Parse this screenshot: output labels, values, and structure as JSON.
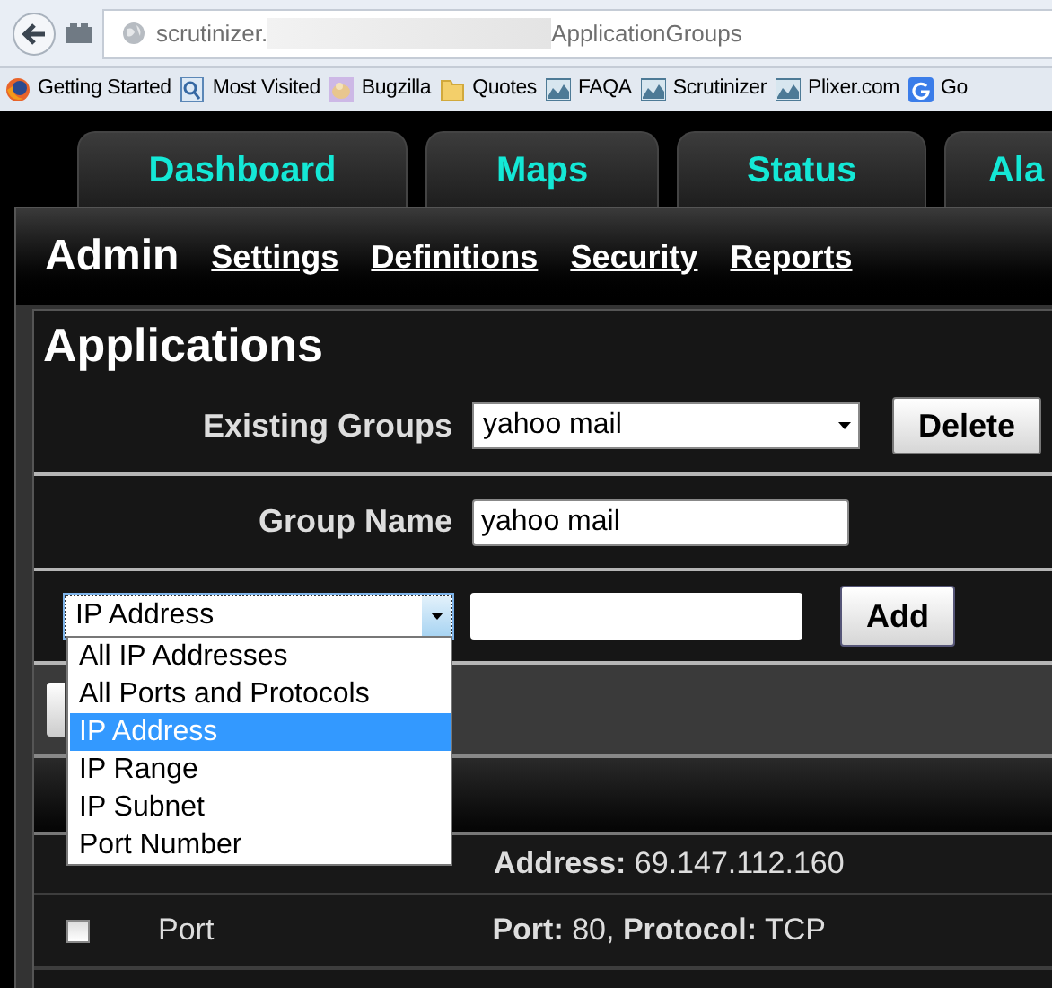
{
  "browser": {
    "url_start": "scrutinizer.",
    "url_end": "ApplicationGroups"
  },
  "bookmarks": [
    {
      "label": "Getting Started",
      "kind": "firefox"
    },
    {
      "label": "Most Visited",
      "kind": "page"
    },
    {
      "label": "Bugzilla",
      "kind": "bug"
    },
    {
      "label": "Quotes",
      "kind": "folder"
    },
    {
      "label": "FAQA",
      "kind": "chart"
    },
    {
      "label": "Scrutinizer",
      "kind": "chart"
    },
    {
      "label": "Plixer.com",
      "kind": "chart"
    },
    {
      "label": "Go",
      "kind": "google"
    }
  ],
  "tabs": [
    {
      "label": "Dashboard"
    },
    {
      "label": "Maps"
    },
    {
      "label": "Status"
    },
    {
      "label": "Ala"
    }
  ],
  "admin": {
    "title": "Admin",
    "links": [
      "Settings",
      "Definitions",
      "Security",
      "Reports"
    ]
  },
  "panel": {
    "title": "Applications",
    "existing_groups": {
      "label": "Existing Groups",
      "value": "yahoo mail",
      "button": "Delete"
    },
    "group_name": {
      "label": "Group Name",
      "value": "yahoo mail"
    },
    "add_row": {
      "type_value": "IP Address",
      "button": "Add",
      "options": [
        {
          "label": "All IP Addresses",
          "selected": false
        },
        {
          "label": "All Ports and Protocols",
          "selected": false
        },
        {
          "label": "IP Address",
          "selected": true
        },
        {
          "label": "IP Range",
          "selected": false
        },
        {
          "label": "IP Subnet",
          "selected": false
        },
        {
          "label": "Port Number",
          "selected": false
        }
      ]
    },
    "rows": [
      {
        "value": "**Address:** 69.147.112.160"
      },
      {
        "checked": false,
        "type": "Port",
        "value": "**Port:** 80, **Protocol:** TCP"
      }
    ]
  }
}
